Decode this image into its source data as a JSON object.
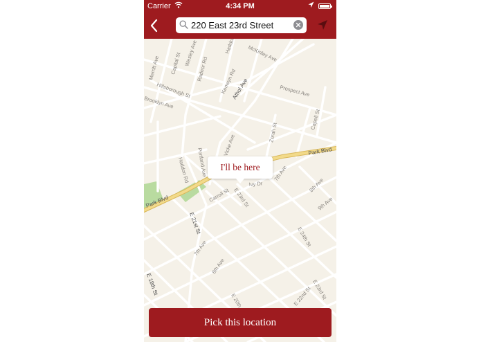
{
  "status_bar": {
    "carrier": "Carrier",
    "time": "4:34 PM"
  },
  "search": {
    "value": "220 East 23rd Street"
  },
  "map": {
    "streets": [
      "Merritt Ave",
      "Capital St",
      "Wesley Ave",
      "Radnor Rd",
      "Haddon Rd",
      "McKinley Ave",
      "Hillsborough St",
      "Kenwyn Rd",
      "Athol Ave",
      "Prospect Ave",
      "Brooklyn Ave",
      "Capell St",
      "Zorah St",
      "Park Blvd",
      "Portland Ave",
      "Haddon Rd",
      "Ivy Dr",
      "Carroll St",
      "E 23rd St",
      "7th Ave",
      "8th Ave",
      "9th Ave",
      "Park Blvd",
      "E 21st St",
      "7th Ave",
      "E 24th St",
      "8th Ave",
      "E 18th St",
      "E 20th St",
      "E 23rd St",
      "E 22nd St",
      "Vicke Ave"
    ],
    "callout_label": "I'll be here"
  },
  "pick_button": {
    "label": "Pick this location"
  },
  "colors": {
    "brand": "#9e1b1f",
    "map_bg": "#f5f1e8",
    "major_road": "#f2da8a",
    "park": "#b9dba0"
  }
}
